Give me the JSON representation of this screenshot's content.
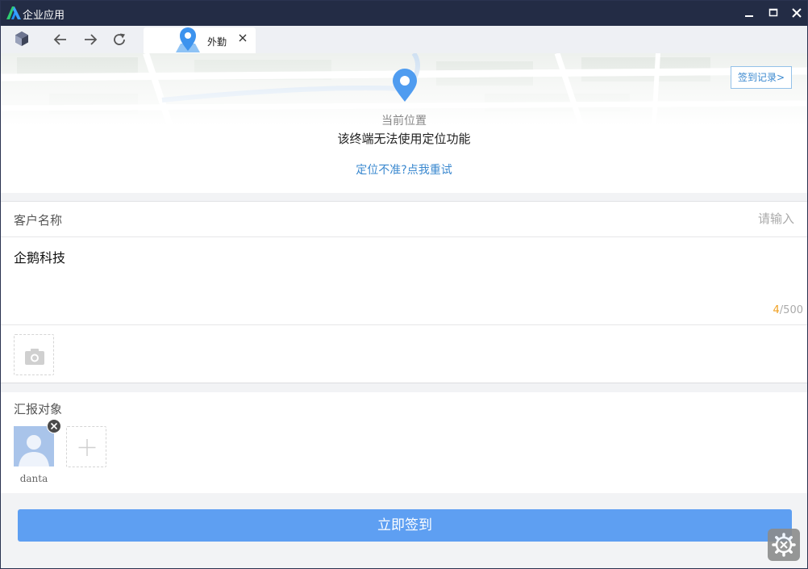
{
  "window": {
    "title": "企业应用",
    "controls": {
      "minimize": "minimize-icon",
      "maximize": "maximize-icon",
      "close": "close-icon"
    }
  },
  "toolbar": {
    "icons": [
      "app-cube-icon",
      "back-arrow-icon",
      "forward-arrow-icon",
      "refresh-icon"
    ]
  },
  "tab": {
    "label": "外勤",
    "icon": "location-pin-icon",
    "close_icon": "close-icon"
  },
  "location": {
    "record_button": "签到记录>",
    "current_label": "当前位置",
    "status": "该终端无法使用定位功能",
    "retry_link": "定位不准?点我重试"
  },
  "form": {
    "customer_label": "客户名称",
    "customer_placeholder": "请输入",
    "note_text": "企鹅科技",
    "note_count_current": "4",
    "note_count_max": "/500",
    "photo_icon": "camera-icon"
  },
  "report": {
    "title": "汇报对象",
    "members": [
      {
        "name": "danta"
      }
    ],
    "add_icon": "plus-icon"
  },
  "submit_label": "立即签到",
  "colors": {
    "titlebar": "#232c45",
    "accent": "#3a88cf",
    "primary_button": "#5e9ff2",
    "count_highlight": "#f0a020"
  }
}
